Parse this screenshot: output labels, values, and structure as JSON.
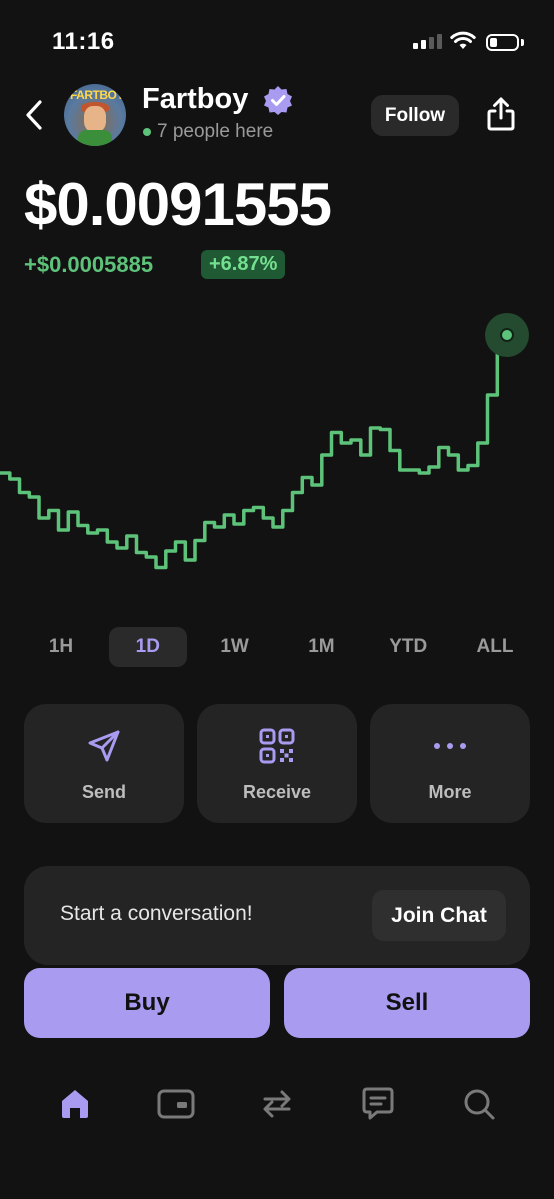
{
  "status_bar": {
    "time": "11:16"
  },
  "header": {
    "token_name": "Fartboy",
    "avatar_text": "FARTBOY",
    "online_text": "7 people here",
    "follow_label": "Follow"
  },
  "price": {
    "value": "$0.0091555",
    "change": "+$0.0005885",
    "change_pct": "+6.87%"
  },
  "chart_data": {
    "type": "line",
    "color": "#5ec37a",
    "values": [
      0.00868,
      0.00864,
      0.00855,
      0.00852,
      0.00838,
      0.00843,
      0.0083,
      0.00842,
      0.00833,
      0.00828,
      0.0083,
      0.00822,
      0.00818,
      0.00826,
      0.00815,
      0.00812,
      0.00805,
      0.00816,
      0.00822,
      0.0081,
      0.00823,
      0.00835,
      0.00832,
      0.0084,
      0.00834,
      0.00843,
      0.00845,
      0.00838,
      0.00832,
      0.00843,
      0.00855,
      0.00865,
      0.0086,
      0.0088,
      0.00895,
      0.00888,
      0.0089,
      0.0088,
      0.00898,
      0.00897,
      0.00883,
      0.0087,
      0.0087,
      0.00868,
      0.00872,
      0.00885,
      0.0088,
      0.0087,
      0.00873,
      0.00888,
      0.0092,
      0.00955,
      0.0096
    ]
  },
  "ranges": [
    "1H",
    "1D",
    "1W",
    "1M",
    "YTD",
    "ALL"
  ],
  "active_range": "1D",
  "actions": {
    "send": "Send",
    "receive": "Receive",
    "more": "More"
  },
  "chat": {
    "prompt": "Start a conversation!",
    "join_label": "Join Chat"
  },
  "trade": {
    "buy_label": "Buy",
    "sell_label": "Sell"
  },
  "colors": {
    "accent": "#a99bf0",
    "positive": "#5ec37a",
    "background": "#121212"
  },
  "tab_bar": [
    "home-icon",
    "wallet-icon",
    "swap-icon",
    "chat-icon",
    "search-icon"
  ]
}
